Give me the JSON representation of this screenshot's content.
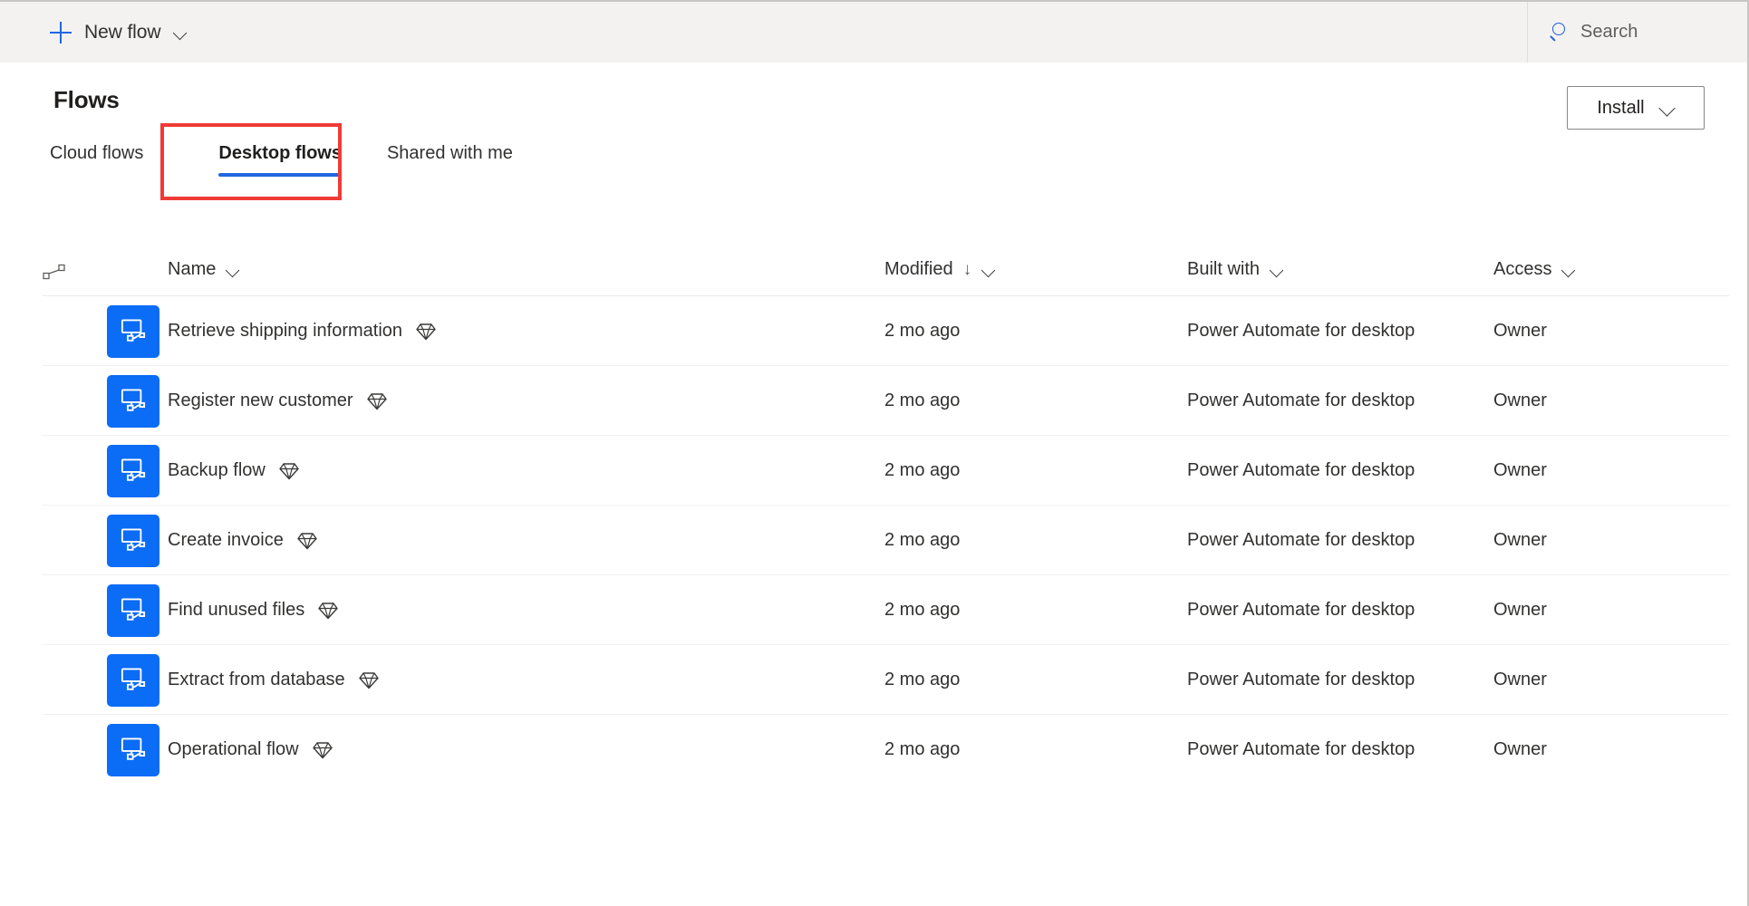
{
  "commandbar": {
    "new_flow_label": "New flow",
    "new_flow_icon": "plus-icon",
    "new_flow_chevron": "chevron-down-icon",
    "search_placeholder": "Search",
    "search_icon": "search-icon"
  },
  "header": {
    "title": "Flows",
    "install_label": "Install",
    "install_chevron": "chevron-down-icon"
  },
  "tabs": [
    {
      "label": "Cloud flows",
      "selected": false
    },
    {
      "label": "Desktop flows",
      "selected": true
    },
    {
      "label": "Shared with me",
      "selected": false
    }
  ],
  "annotation": {
    "type": "red-highlight-box",
    "target": "Desktop flows",
    "color": "#ef3b36"
  },
  "table": {
    "columns": [
      {
        "key": "flow",
        "label": "",
        "icon": "flow-connector-icon",
        "chevron": false,
        "sorted": false
      },
      {
        "key": "name",
        "label": "Name",
        "chevron": "chevron-down-icon",
        "sorted": false
      },
      {
        "key": "modified",
        "label": "Modified",
        "chevron": "chevron-down-icon",
        "sorted": true,
        "sort_arrow": "↓"
      },
      {
        "key": "built_with",
        "label": "Built with",
        "chevron": "chevron-down-icon",
        "sorted": false
      },
      {
        "key": "access",
        "label": "Access",
        "chevron": "chevron-down-icon",
        "sorted": false
      }
    ],
    "rows": [
      {
        "icon": "desktop-flow-icon",
        "name": "Retrieve shipping information",
        "premium": "premium-diamond-icon",
        "modified": "2 mo ago",
        "built_with": "Power Automate for desktop",
        "access": "Owner"
      },
      {
        "icon": "desktop-flow-icon",
        "name": "Register new customer",
        "premium": "premium-diamond-icon",
        "modified": "2 mo ago",
        "built_with": "Power Automate for desktop",
        "access": "Owner"
      },
      {
        "icon": "desktop-flow-icon",
        "name": "Backup flow",
        "premium": "premium-diamond-icon",
        "modified": "2 mo ago",
        "built_with": "Power Automate for desktop",
        "access": "Owner"
      },
      {
        "icon": "desktop-flow-icon",
        "name": "Create invoice",
        "premium": "premium-diamond-icon",
        "modified": "2 mo ago",
        "built_with": "Power Automate for desktop",
        "access": "Owner"
      },
      {
        "icon": "desktop-flow-icon",
        "name": "Find unused files",
        "premium": "premium-diamond-icon",
        "modified": "2 mo ago",
        "built_with": "Power Automate for desktop",
        "access": "Owner"
      },
      {
        "icon": "desktop-flow-icon",
        "name": "Extract from database",
        "premium": "premium-diamond-icon",
        "modified": "2 mo ago",
        "built_with": "Power Automate for desktop",
        "access": "Owner"
      },
      {
        "icon": "desktop-flow-icon",
        "name": "Operational flow",
        "premium": "premium-diamond-icon",
        "modified": "2 mo ago",
        "built_with": "Power Automate for desktop",
        "access": "Owner"
      }
    ]
  },
  "colors": {
    "accent_blue": "#2266e3",
    "tile_blue": "#0b6cf5",
    "commandbar_bg": "#f3f2f1",
    "annotation_red": "#ef3b36",
    "text_primary": "#323130"
  }
}
